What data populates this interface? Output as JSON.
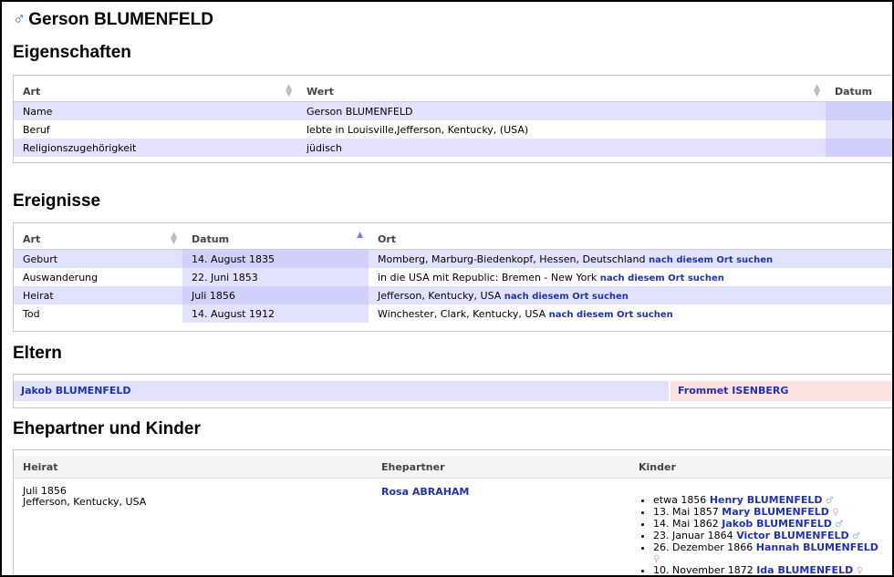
{
  "person": {
    "symbol": "♂",
    "name": "Gerson BLUMENFELD"
  },
  "props": {
    "heading": "Eigenschaften",
    "columns": [
      "Art",
      "Wert",
      "Datum"
    ],
    "rows": [
      {
        "art": "Name",
        "wert": "Gerson BLUMENFELD"
      },
      {
        "art": "Beruf",
        "wert": "lebte in Louisville,Jefferson, Kentucky, (USA)"
      },
      {
        "art": "Religionszugehörigkeit",
        "wert": "jüdisch"
      }
    ]
  },
  "events": {
    "heading": "Ereignisse",
    "columns": [
      "Art",
      "Datum",
      "Ort"
    ],
    "search_link": "nach diesem Ort suchen",
    "rows": [
      {
        "art": "Geburt",
        "datum": "14. August 1835",
        "ort": "Momberg, Marburg-Biedenkopf, Hessen, Deutschland"
      },
      {
        "art": "Auswanderung",
        "datum": "22. Juni 1853",
        "ort": "in die USA mit Republic: Bremen - New York"
      },
      {
        "art": "Heirat",
        "datum": "Juli 1856",
        "ort": "Jefferson, Kentucky, USA"
      },
      {
        "art": "Tod",
        "datum": "14. August 1912",
        "ort": "Winchester, Clark, Kentucky, USA"
      }
    ]
  },
  "parents": {
    "heading": "Eltern",
    "father": "Jakob BLUMENFELD",
    "mother": "Frommet ISENBERG"
  },
  "family": {
    "heading": "Ehepartner und Kinder",
    "columns": [
      "Heirat",
      "Ehepartner",
      "Kinder"
    ],
    "marriage_date": "Juli 1856",
    "marriage_place": "Jefferson, Kentucky, USA",
    "spouse": "Rosa ABRAHAM",
    "children": [
      {
        "date": "etwa 1856",
        "name": "Henry BLUMENFELD",
        "sex": "♂"
      },
      {
        "date": "13. Mai 1857",
        "name": "Mary BLUMENFELD",
        "sex": "♀"
      },
      {
        "date": "14. Mai 1862",
        "name": "Jakob BLUMENFELD",
        "sex": "♂"
      },
      {
        "date": "23. Januar 1864",
        "name": "Victor BLUMENFELD",
        "sex": "♂"
      },
      {
        "date": "26. Dezember 1866",
        "name": "Hannah BLUMENFELD",
        "sex": "♀"
      },
      {
        "date": "10. November 1872",
        "name": "Ida BLUMENFELD",
        "sex": "♀"
      }
    ]
  }
}
